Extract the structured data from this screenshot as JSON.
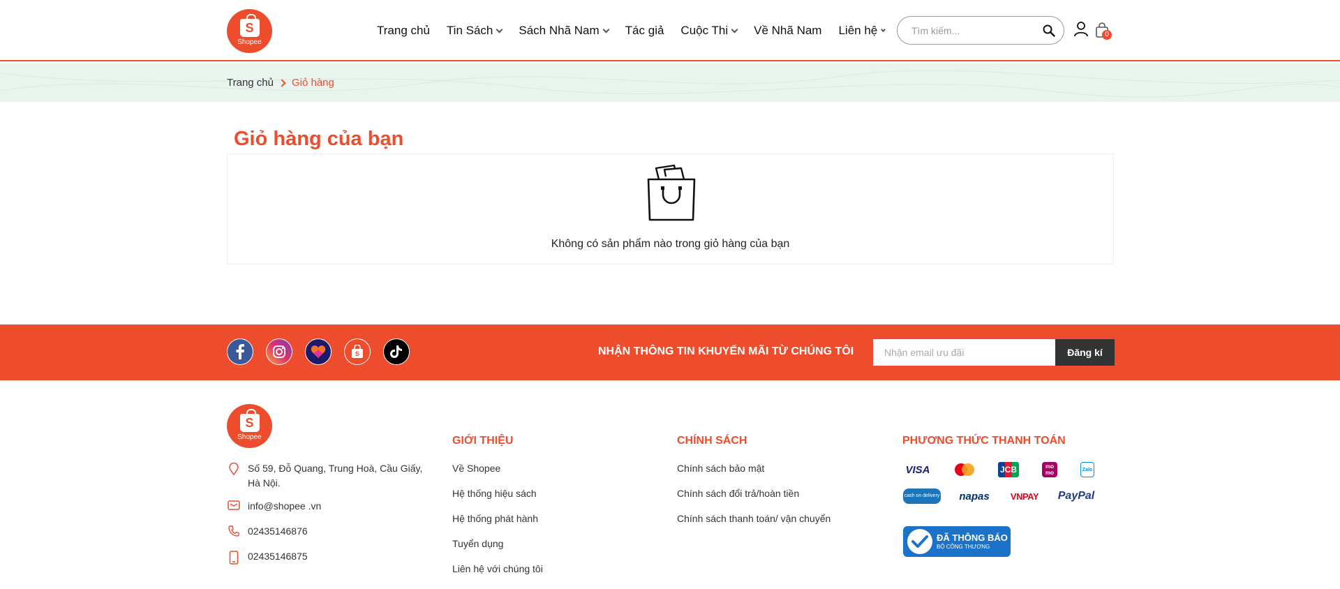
{
  "header": {
    "logo_text": "Shopee",
    "logo_letter": "S",
    "nav": [
      {
        "label": "Trang chủ",
        "dropdown": false
      },
      {
        "label": "Tin Sách",
        "dropdown": true
      },
      {
        "label": "Sách Nhã Nam",
        "dropdown": true
      },
      {
        "label": "Tác giả",
        "dropdown": false
      },
      {
        "label": "Cuộc Thi",
        "dropdown": true
      },
      {
        "label": "Về Nhã Nam",
        "dropdown": false
      },
      {
        "label": "Liên hệ",
        "dropdown": true
      }
    ],
    "search_placeholder": "Tìm kiếm...",
    "cart_count": "0"
  },
  "breadcrumb": {
    "home": "Trang chủ",
    "current": "Giỏ hàng"
  },
  "cart": {
    "title": "Giỏ hàng của bạn",
    "empty_message": "Không có sản phẩm nào trong giỏ hàng của bạn"
  },
  "newsletter": {
    "title": "NHẬN THÔNG TIN KHUYẾN MÃI TỪ CHÚNG TÔI",
    "placeholder": "Nhận email ưu đãi",
    "button": "Đăng kí",
    "socials": [
      "facebook-icon",
      "instagram-icon",
      "lazada-icon",
      "shopee-icon",
      "tiktok-icon"
    ]
  },
  "footer": {
    "logo_text": "Shopee",
    "logo_letter": "S",
    "address": "Số 59, Đỗ Quang, Trung Hoà, Cầu Giấy, Hà Nội.",
    "email": "info@shopee .vn",
    "phone1": "02435146876",
    "phone2": "02435146875",
    "about": {
      "title": "GIỚI THIỆU",
      "links": [
        "Về Shopee",
        "Hệ thống hiệu sách",
        "Hệ thống phát hành",
        "Tuyển dụng",
        "Liên hệ với chúng tôi"
      ]
    },
    "policy": {
      "title": "CHÍNH SÁCH",
      "links": [
        "Chính sách bảo mật",
        "Chính sách đổi trả/hoàn tiền",
        "Chính sách thanh toán/ vận chuyển"
      ]
    },
    "payment": {
      "title": "PHƯƠNG THỨC THANH TOÁN",
      "methods": [
        "VISA",
        "mastercard",
        "JCB",
        "momo",
        "zalopay",
        "cash on delivery",
        "napas",
        "VNPAY",
        "PayPal"
      ],
      "cash_label": "cash on delivery",
      "visa": "VISA",
      "jcb": "JCB",
      "momo": "mo mo",
      "napas": "napas",
      "vnpay": "VNPAY",
      "paypal": "PayPal",
      "zalo": "Zalo"
    },
    "bct": {
      "line1": "ĐÃ THÔNG BÁO",
      "line2": "BỘ CÔNG THƯƠNG"
    }
  },
  "colors": {
    "brand": "#ee4d2d",
    "breadcrumb_bg": "#eaf4ee",
    "button_dark": "#333333"
  }
}
